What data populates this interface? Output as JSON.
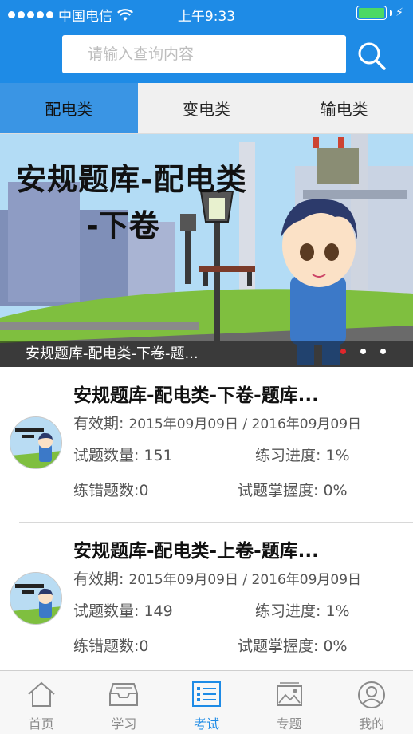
{
  "status_bar": {
    "carrier": "中国电信",
    "time": "上午9:33"
  },
  "search": {
    "placeholder": "请输入查询内容"
  },
  "tabs": [
    {
      "label": "配电类",
      "active": true
    },
    {
      "label": "变电类",
      "active": false
    },
    {
      "label": "输电类",
      "active": false
    }
  ],
  "banner": {
    "title_line1": "安规题库-配电类",
    "title_line2": "-下卷",
    "caption": "安规题库-配电类-下卷-题...",
    "page_count": 3,
    "active_page": 1
  },
  "items": [
    {
      "title": "安规题库-配电类-下卷-题库...",
      "validity_label": "有效期:",
      "validity_value": "2015年09月09日 / 2016年09月09日",
      "count_label": "试题数量:",
      "count_value": "151",
      "progress_label": "练习进度:",
      "progress_value": "1%",
      "wrong_label": "练错题数:",
      "wrong_value": "0",
      "mastery_label": "试题掌握度:",
      "mastery_value": "0%"
    },
    {
      "title": "安规题库-配电类-上卷-题库...",
      "validity_label": "有效期:",
      "validity_value": "2015年09月09日 / 2016年09月09日",
      "count_label": "试题数量:",
      "count_value": "149",
      "progress_label": "练习进度:",
      "progress_value": "1%",
      "wrong_label": "练错题数:",
      "wrong_value": "0",
      "mastery_label": "试题掌握度:",
      "mastery_value": "0%"
    }
  ],
  "bottom_nav": [
    {
      "label": "首页",
      "icon": "home-icon",
      "active": false
    },
    {
      "label": "学习",
      "icon": "inbox-icon",
      "active": false
    },
    {
      "label": "考试",
      "icon": "exam-list-icon",
      "active": true
    },
    {
      "label": "专题",
      "icon": "picture-icon",
      "active": false
    },
    {
      "label": "我的",
      "icon": "user-icon",
      "active": false
    }
  ],
  "colors": {
    "header_blue": "#1e8be6",
    "tab_active": "#3a95e4",
    "pager_active": "#e0262b",
    "battery": "#4cd964"
  }
}
